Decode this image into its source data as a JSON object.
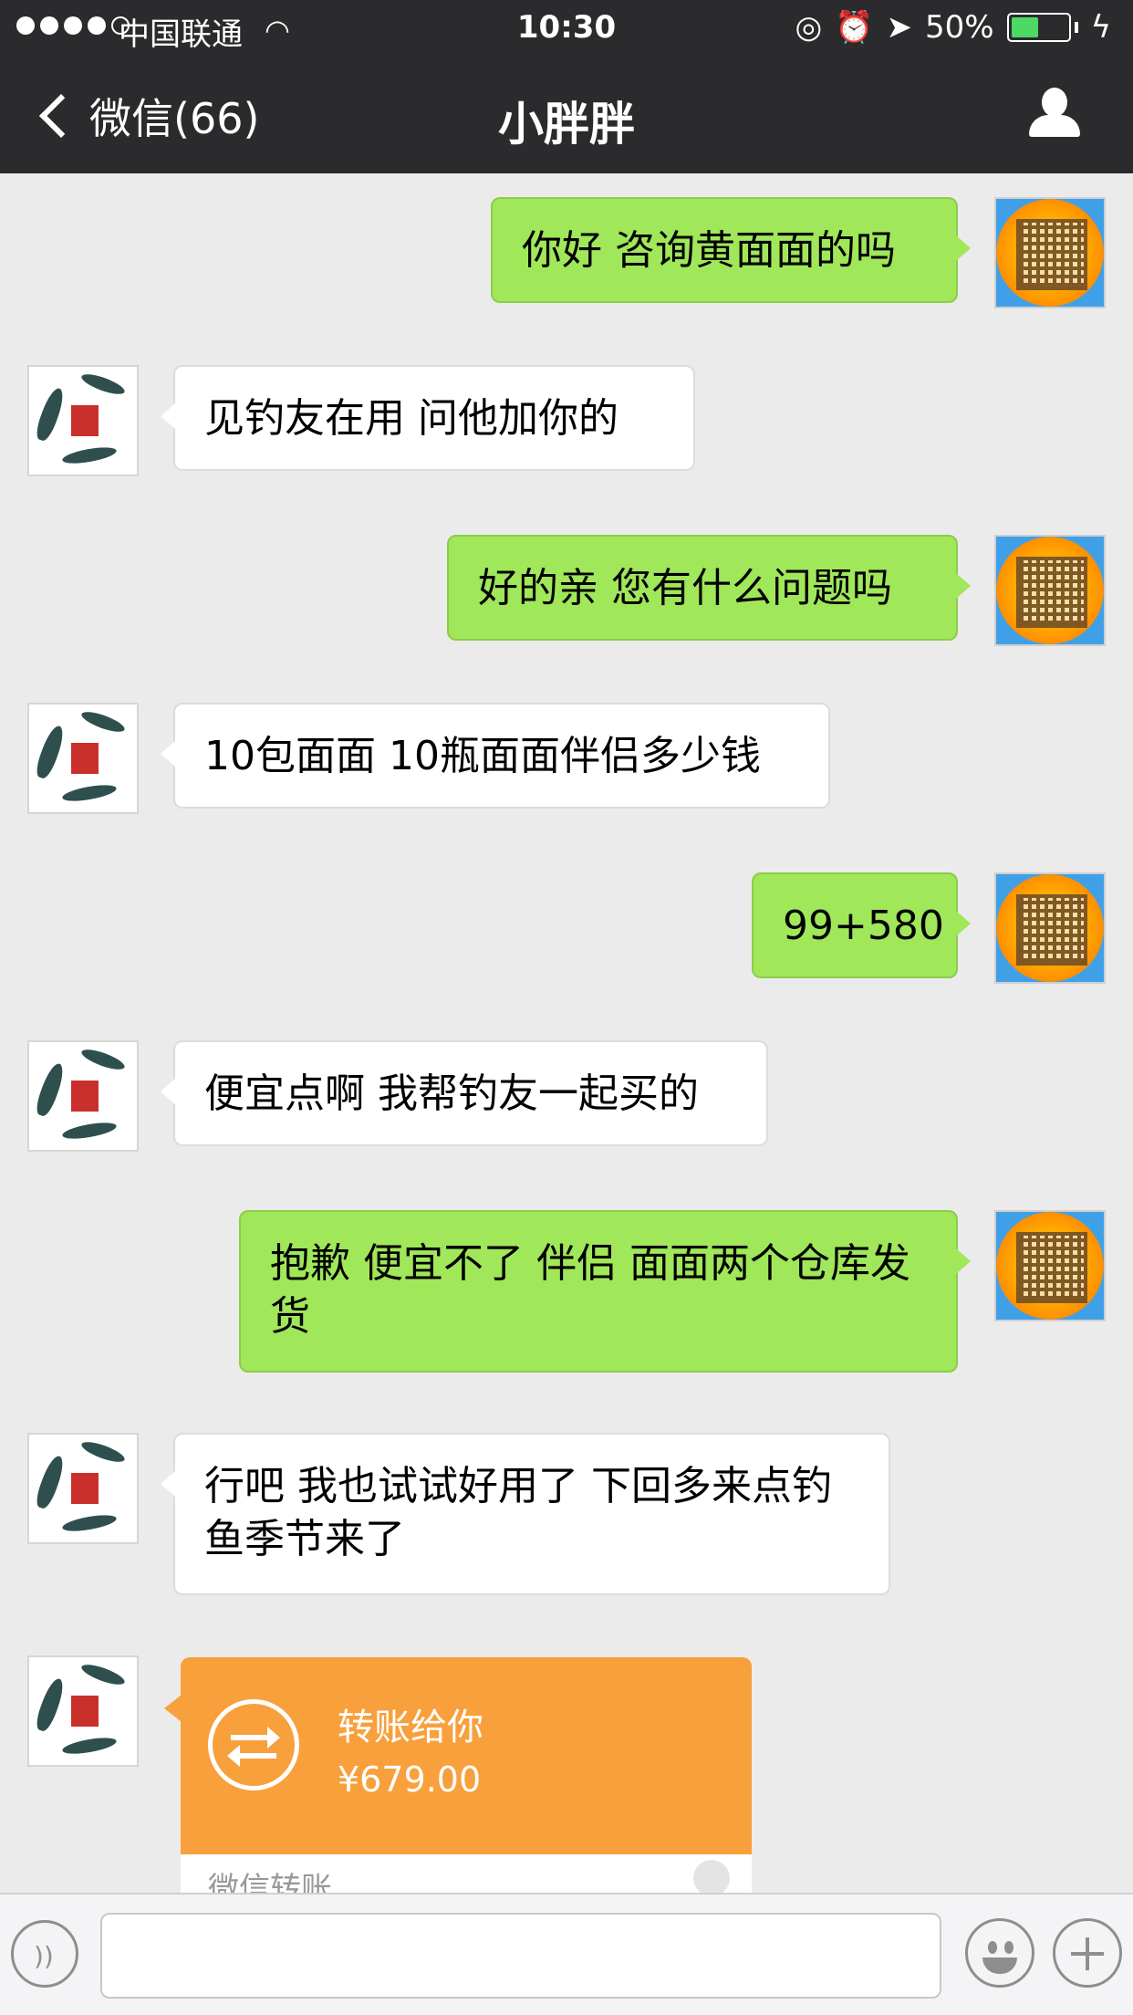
{
  "status_bar": {
    "carrier": "中国联通",
    "time": "10:30",
    "battery": "50%",
    "battery_level": 0.5
  },
  "nav": {
    "back_label": "微信(66)",
    "title": "小胖胖"
  },
  "messages": [
    {
      "from": "me",
      "text": "你好 咨询黄面面的吗"
    },
    {
      "from": "other",
      "text": "见钓友在用 问他加你的"
    },
    {
      "from": "me",
      "text": "好的亲 您有什么问题吗"
    },
    {
      "from": "other",
      "text": "10包面面 10瓶面面伴侣多少钱"
    },
    {
      "from": "me",
      "text": "99+580"
    },
    {
      "from": "other",
      "text": "便宜点啊 我帮钓友一起买的"
    },
    {
      "from": "me",
      "text": "抱歉 便宜不了 伴侣 面面两个仓库发货"
    },
    {
      "from": "other",
      "text": "行吧 我也试试好用了 下回多来点钓鱼季节来了"
    }
  ],
  "transfer": {
    "title": "转账给你",
    "amount": "¥679.00",
    "footer": "微信转账"
  },
  "colors": {
    "nav_bg": "#2b2b2e",
    "my_bubble": "#a0e75a",
    "transfer": "#f8a03c",
    "chat_bg": "#ebebeb"
  }
}
